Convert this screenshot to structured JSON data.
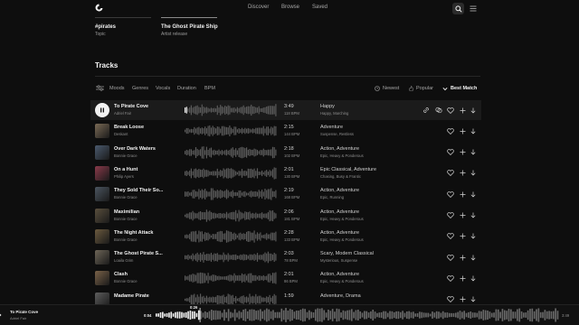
{
  "header": {
    "nav": [
      "Discover",
      "Browse",
      "Saved"
    ],
    "logo_icon": "logo-icon",
    "search_icon": "search-icon",
    "menu_icon": "hamburger-menu-icon"
  },
  "cards": [
    {
      "title": "#pirates",
      "subtitle": "Topic"
    },
    {
      "title": "The Ghost Pirate Ship",
      "subtitle": "Artist release"
    }
  ],
  "section_title": "Tracks",
  "filters": [
    "Moods",
    "Genres",
    "Vocals",
    "Duration",
    "BPM"
  ],
  "sort_options": [
    {
      "label": "Newest",
      "icon": "clock-icon"
    },
    {
      "label": "Popular",
      "icon": "flame-icon"
    },
    {
      "label": "Best Match",
      "icon": "chevron-down-icon",
      "active": true
    }
  ],
  "tracks": [
    {
      "title": "To Pirate Cove",
      "artist": "Adriel Fair",
      "duration": "3:49",
      "bpm": "118 BPM",
      "genre": "Happy",
      "tags": "Happy, Marching",
      "playing": true,
      "progress": 0.02,
      "thumb": "#3a3a3a"
    },
    {
      "title": "Break Loose",
      "artist": "Deskant",
      "duration": "2:15",
      "bpm": "144 BPM",
      "genre": "Adventure",
      "tags": "Suspense, Restless",
      "thumb": "#7a6a55"
    },
    {
      "title": "Over Dark Waters",
      "artist": "Bonnie Grace",
      "duration": "2:18",
      "bpm": "102 BPM",
      "genre": "Action, Adventure",
      "tags": "Epic, Heavy & Ponderous",
      "thumb": "#4a5a6e"
    },
    {
      "title": "On a Hunt",
      "artist": "Philip Ayers",
      "duration": "2:01",
      "bpm": "130 BPM",
      "genre": "Epic Classical, Adventure",
      "tags": "Chasing, Busy & Frantic",
      "thumb": "#8a3a4a"
    },
    {
      "title": "They Sold Their So...",
      "artist": "Bonnie Grace",
      "duration": "2:19",
      "bpm": "168 BPM",
      "genre": "Action, Adventure",
      "tags": "Epic, Running",
      "thumb": "#4b5560"
    },
    {
      "title": "Maximilian",
      "artist": "Bonnie Grace",
      "duration": "2:06",
      "bpm": "181 BPM",
      "genre": "Action, Adventure",
      "tags": "Epic, Heavy & Ponderous",
      "thumb": "#5a4f3d"
    },
    {
      "title": "The Night Attack",
      "artist": "Bonnie Grace",
      "duration": "2:28",
      "bpm": "133 BPM",
      "genre": "Action, Adventure",
      "tags": "Epic, Heavy & Ponderous",
      "thumb": "#6b5a3e"
    },
    {
      "title": "The Ghost Pirate S...",
      "artist": "Loaila Grim",
      "duration": "2:03",
      "bpm": "78 BPM",
      "genre": "Scary, Modern Classical",
      "tags": "Mysterious, Suspense",
      "thumb": "#6e6658"
    },
    {
      "title": "Clash",
      "artist": "Bonnie Grace",
      "duration": "2:01",
      "bpm": "86 BPM",
      "genre": "Action, Adventure",
      "tags": "Epic, Heavy & Ponderous",
      "thumb": "#7a6248"
    },
    {
      "title": "Madame Pirate",
      "artist": "",
      "duration": "1:59",
      "bpm": "",
      "genre": "Adventure, Drama",
      "tags": "",
      "thumb": "#5e5e5e"
    }
  ],
  "player": {
    "title": "To Pirate Cove",
    "artist": "Adriel Fair",
    "elapsed": "0:04",
    "position_label": "0:26",
    "total": "3:49",
    "progress": 0.11,
    "prev_icon": "previous-icon"
  },
  "colors": {
    "accent": "#f2f2f2",
    "background": "#0e0e0e",
    "playing_row": "#1b1b1b"
  }
}
